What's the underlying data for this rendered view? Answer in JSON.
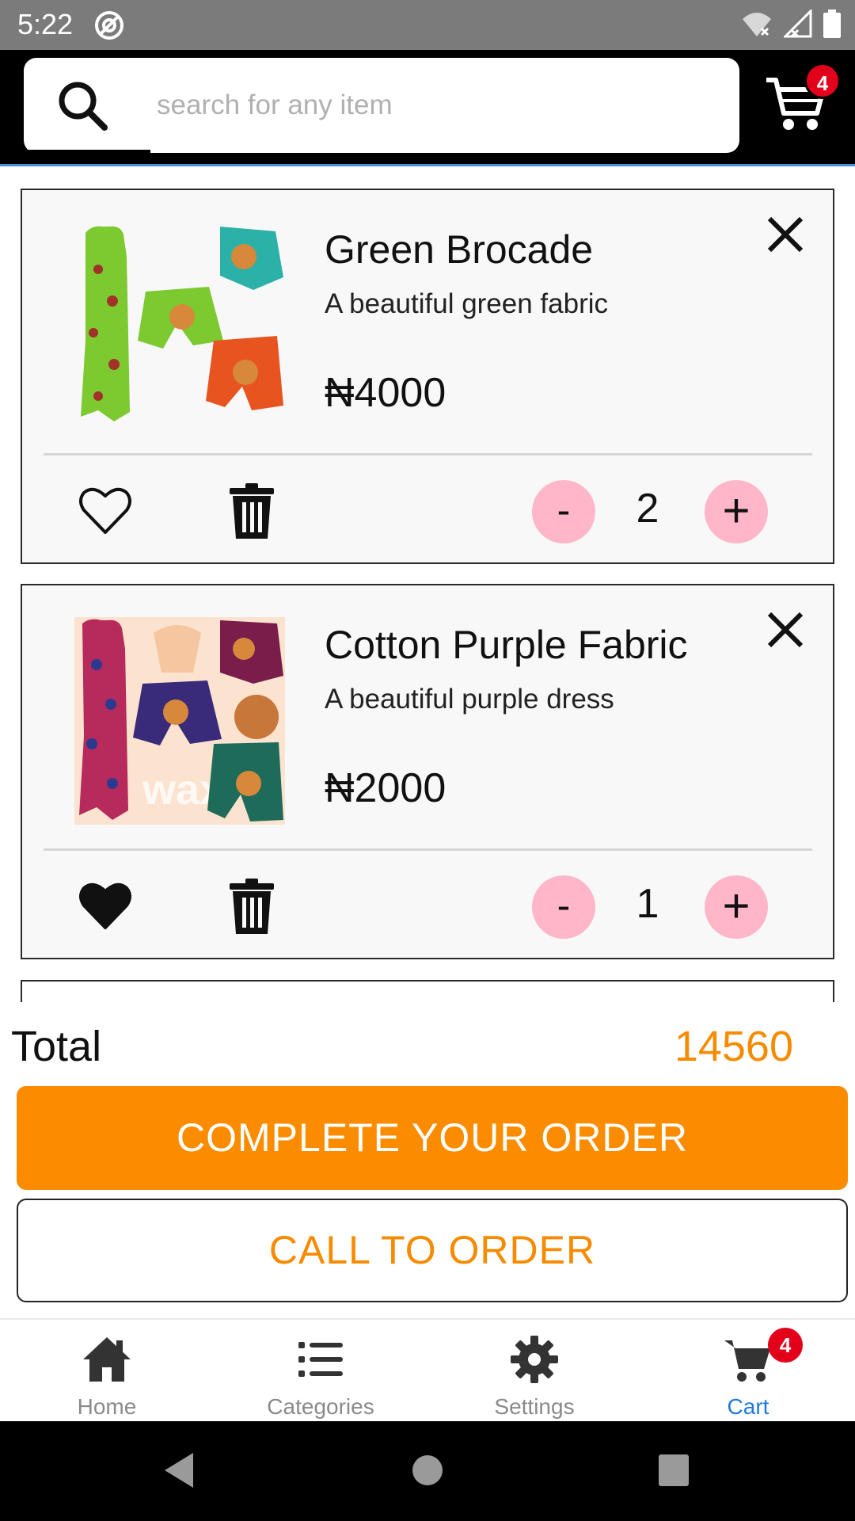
{
  "status_bar": {
    "time": "5:22"
  },
  "header": {
    "search_placeholder": "search for any item",
    "cart_badge": "4"
  },
  "cart": {
    "items": [
      {
        "title": "Green Brocade",
        "description": "A beautiful green fabric",
        "price": "₦4000",
        "quantity": "2",
        "favorited": false,
        "image_icon": "green-fabric-product-image",
        "minus_label": "-",
        "plus_label": "+"
      },
      {
        "title": "Cotton Purple Fabric",
        "description": "A beautiful purple dress",
        "price": "₦2000",
        "quantity": "1",
        "favorited": true,
        "image_icon": "purple-fabric-product-image",
        "minus_label": "-",
        "plus_label": "+"
      }
    ]
  },
  "summary": {
    "total_label": "Total",
    "total_value": "14560",
    "complete_label": "COMPLETE YOUR ORDER",
    "call_label": "CALL TO ORDER"
  },
  "bottom_nav": {
    "items": [
      {
        "label": "Home",
        "icon": "home-icon"
      },
      {
        "label": "Categories",
        "icon": "list-icon"
      },
      {
        "label": "Settings",
        "icon": "gear-icon"
      },
      {
        "label": "Cart",
        "icon": "cart-icon",
        "badge": "4",
        "active": true
      }
    ]
  },
  "colors": {
    "accent": "#fb8c00",
    "price_accent": "#f68b00",
    "active_nav": "#1f7ae0",
    "qty_button": "#ffb6c8",
    "badge": "#e3001b"
  }
}
